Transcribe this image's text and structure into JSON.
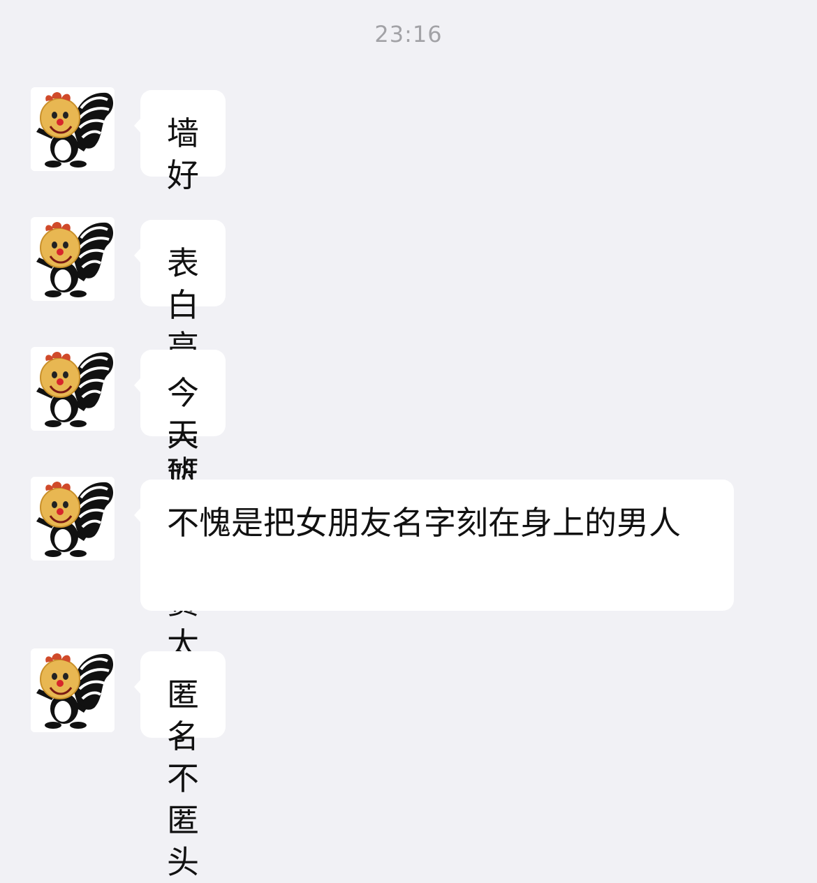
{
  "chat": {
    "timestamp": "23:16",
    "avatar_icon": "skunk-cartoon-avatar-icon",
    "messages": [
      {
        "text": "墙好"
      },
      {
        "text": "表白高一四班 ljh"
      },
      {
        "text": "今天篮球比赛太帅了"
      },
      {
        "text": "不愧是把女朋友名字刻在身上的男人"
      },
      {
        "text": "匿名不匿头"
      }
    ]
  }
}
